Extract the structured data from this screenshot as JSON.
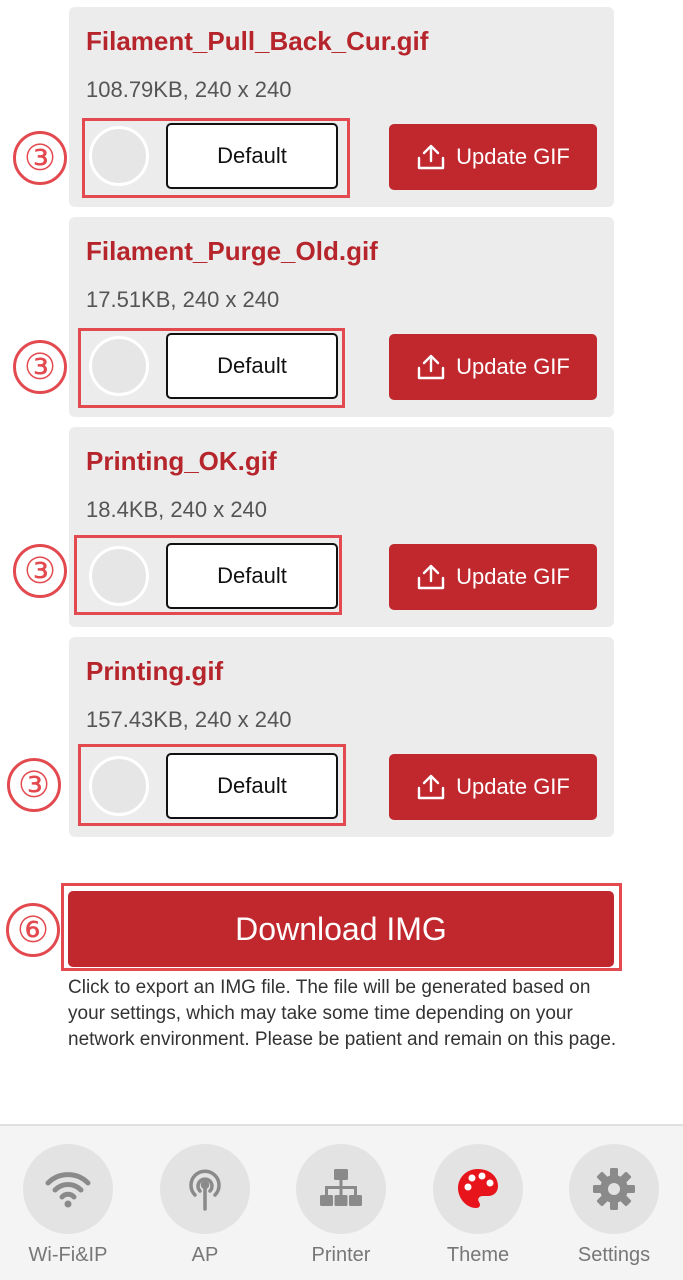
{
  "files": [
    {
      "name": "Filament_Pull_Back_Cur.gif",
      "meta": "108.79KB, 240 x 240",
      "default_label": "Default",
      "update_label": "Update GIF"
    },
    {
      "name": "Filament_Purge_Old.gif",
      "meta": "17.51KB, 240 x 240",
      "default_label": "Default",
      "update_label": "Update GIF"
    },
    {
      "name": "Printing_OK.gif",
      "meta": "18.4KB, 240 x 240",
      "default_label": "Default",
      "update_label": "Update GIF"
    },
    {
      "name": "Printing.gif",
      "meta": "157.43KB, 240 x 240",
      "default_label": "Default",
      "update_label": "Update GIF"
    }
  ],
  "annotations": {
    "file_default_marker": "③",
    "download_marker": "⑥"
  },
  "download": {
    "label": "Download IMG",
    "description": "Click to export an IMG file. The file will be generated based on your settings, which may take some time depending on your network environment. Please be patient and remain on this page."
  },
  "tabbar": {
    "items": [
      {
        "label": "Wi-Fi&IP",
        "icon": "wifi-icon",
        "active": false
      },
      {
        "label": "AP",
        "icon": "antenna-icon",
        "active": false
      },
      {
        "label": "Printer",
        "icon": "network-hierarchy-icon",
        "active": false
      },
      {
        "label": "Theme",
        "icon": "palette-icon",
        "active": true
      },
      {
        "label": "Settings",
        "icon": "gear-icon",
        "active": false
      }
    ]
  },
  "colors": {
    "accent": "#c0282e",
    "annotation": "#e34a4f",
    "active_tab_icon": "#e8141c",
    "inactive_tab_icon": "#8a8a8a"
  }
}
